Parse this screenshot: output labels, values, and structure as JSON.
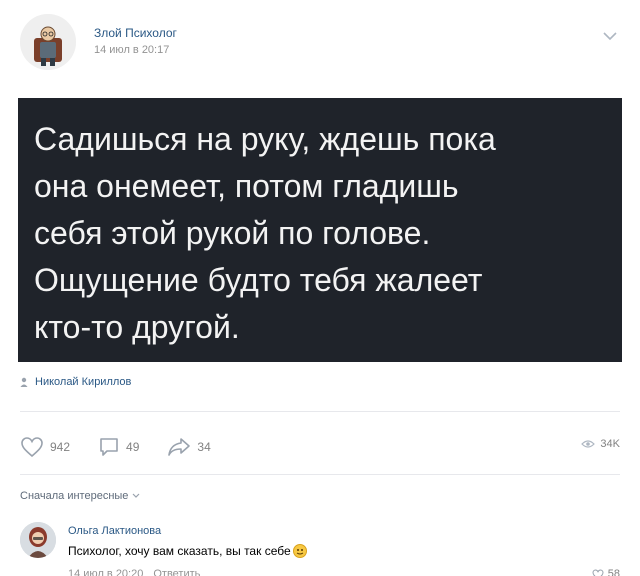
{
  "post": {
    "author": "Злой Психолог",
    "date": "14 июл в 20:17",
    "quote_lines": [
      "Садишься на руку, ждешь пока",
      "она онемеет, потом гладишь",
      "себя этой рукой по голове.",
      "Ощущение будто тебя жалеет",
      "кто-то другой."
    ],
    "signature": "Николай Кириллов"
  },
  "actions": {
    "likes": "942",
    "comments": "49",
    "shares": "34",
    "views": "34K"
  },
  "comments_sort": "Сначала интересные",
  "comment": {
    "author": "Ольга Лактионова",
    "text": "Психолог, хочу вам сказать, вы так себе",
    "meta_date": "14 июл в 20:20",
    "meta_reply": "Ответить",
    "likes": "58"
  },
  "colors": {
    "link": "#2a5885",
    "quote_bg": "#1f232a",
    "icon_gray": "#828282"
  }
}
